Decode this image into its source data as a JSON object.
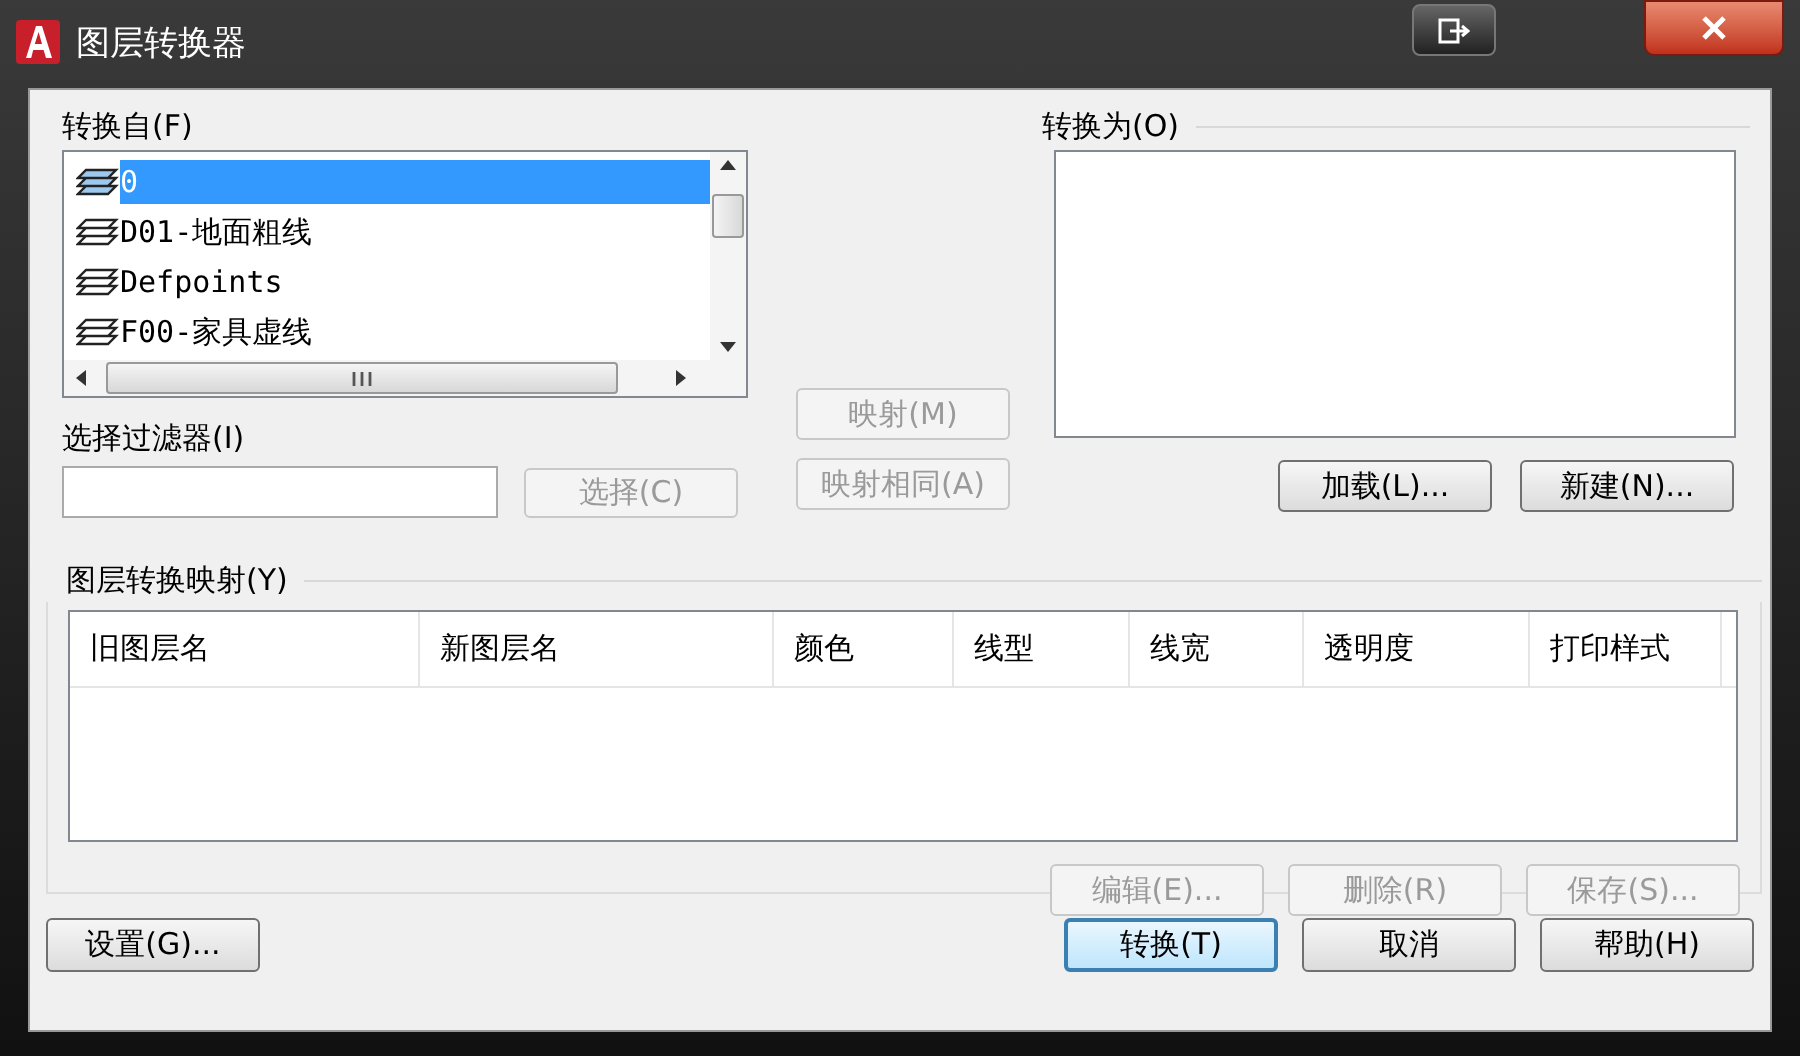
{
  "window": {
    "title": "图层转换器"
  },
  "convert_from": {
    "label": "转换自(F)",
    "layers": [
      {
        "name": "0",
        "selected": true
      },
      {
        "name": "D01-地面粗线",
        "selected": false
      },
      {
        "name": "Defpoints",
        "selected": false
      },
      {
        "name": "F00-家具虚线",
        "selected": false
      }
    ]
  },
  "selection_filter": {
    "label": "选择过滤器(I)",
    "select_button": {
      "label": "选择(C)",
      "disabled": true
    }
  },
  "map_buttons": [
    {
      "label": "映射(M)",
      "disabled": true
    },
    {
      "label": "映射相同(A)",
      "disabled": true
    }
  ],
  "convert_to": {
    "label": "转换为(O)",
    "buttons": [
      {
        "label": "加载(L)...",
        "disabled": false
      },
      {
        "label": "新建(N)...",
        "disabled": false
      }
    ]
  },
  "layer_mappings": {
    "label": "图层转换映射(Y)",
    "columns": [
      "旧图层名",
      "新图层名",
      "颜色",
      "线型",
      "线宽",
      "透明度",
      "打印样式"
    ],
    "buttons": [
      {
        "label": "编辑(E)...",
        "disabled": true
      },
      {
        "label": "删除(R)",
        "disabled": true
      },
      {
        "label": "保存(S)...",
        "disabled": true
      }
    ]
  },
  "settings_button": {
    "label": "设置(G)...",
    "disabled": false
  },
  "footer_buttons": [
    {
      "label": "转换(T)",
      "default": true
    },
    {
      "label": "取消",
      "default": false
    },
    {
      "label": "帮助(H)",
      "default": false
    }
  ]
}
